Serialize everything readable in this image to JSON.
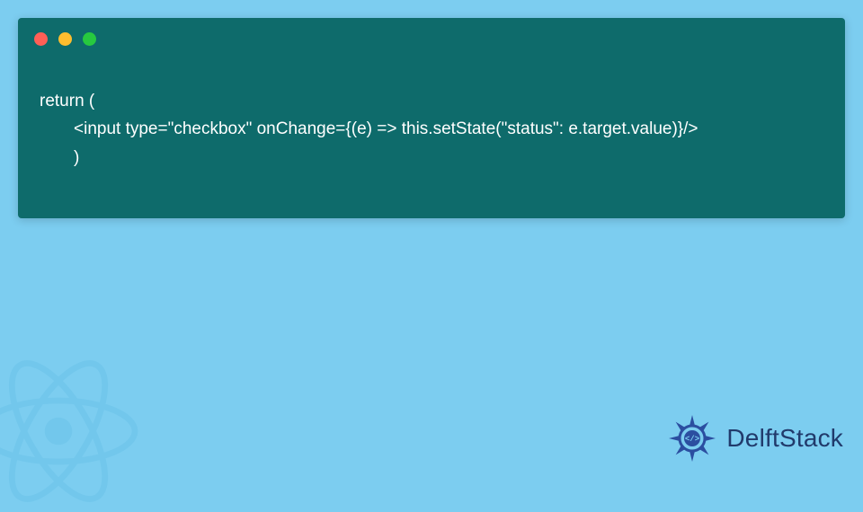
{
  "code": {
    "line1": "return (",
    "line2": "  <input type=\"checkbox\" onChange={(e) => this.setState(\"status\": e.target.value)}/>",
    "line3": "  )"
  },
  "brand": {
    "name": "DelftStack"
  },
  "colors": {
    "background": "#7ccdf0",
    "code_window": "#0e6b6b",
    "brand_text": "#213a6b"
  }
}
